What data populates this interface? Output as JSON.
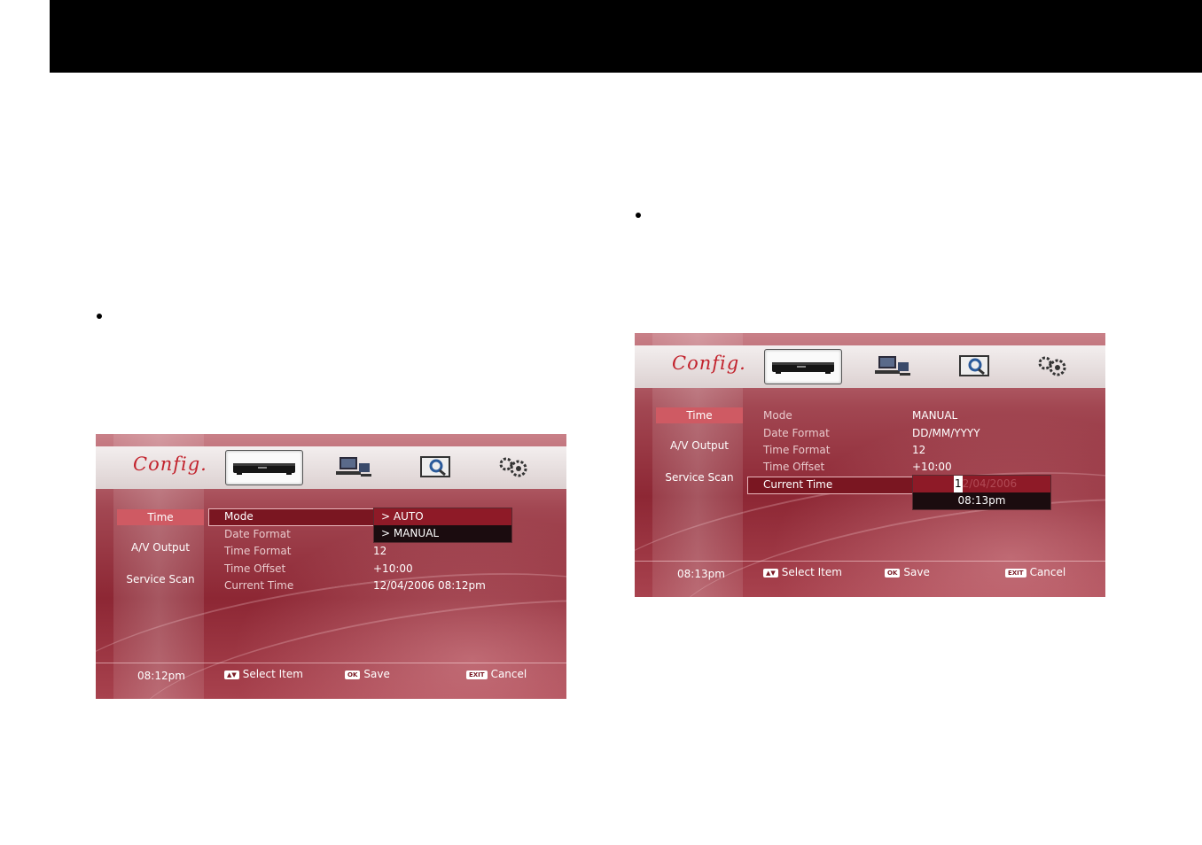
{
  "left_shot": {
    "logo": "Config.",
    "nav": [
      "Time",
      "A/V Output",
      "Service Scan"
    ],
    "rows": [
      {
        "label": "Mode",
        "value": ""
      },
      {
        "label": "Date Format",
        "value": ""
      },
      {
        "label": "Time Format",
        "value": "12"
      },
      {
        "label": "Time Offset",
        "value": "+10:00"
      },
      {
        "label": "Current Time",
        "value": "12/04/2006 08:12pm"
      }
    ],
    "dropdown": [
      {
        "label": ">  AUTO"
      },
      {
        "label": ">  MANUAL"
      }
    ],
    "clock": "08:12pm",
    "keys": {
      "updown": "▲▼",
      "ok": "OK",
      "exit": "EXIT"
    },
    "footer": {
      "select": "Select Item",
      "save": "Save",
      "cancel": "Cancel"
    }
  },
  "right_shot": {
    "logo": "Config.",
    "nav": [
      "Time",
      "A/V Output",
      "Service Scan"
    ],
    "rows": [
      {
        "label": "Mode",
        "value": "MANUAL"
      },
      {
        "label": "Date Format",
        "value": "DD/MM/YYYY"
      },
      {
        "label": "Time Format",
        "value": "12"
      },
      {
        "label": "Time Offset",
        "value": "+10:00"
      },
      {
        "label": "Current Time",
        "value": ""
      }
    ],
    "editor": {
      "date_cursor": "1",
      "date_rest": "2/04/2006",
      "time": "08:13pm"
    },
    "clock": "08:13pm",
    "keys": {
      "updown": "▲▼",
      "ok": "OK",
      "exit": "EXIT"
    },
    "footer": {
      "select": "Select Item",
      "save": "Save",
      "cancel": "Cancel"
    }
  }
}
